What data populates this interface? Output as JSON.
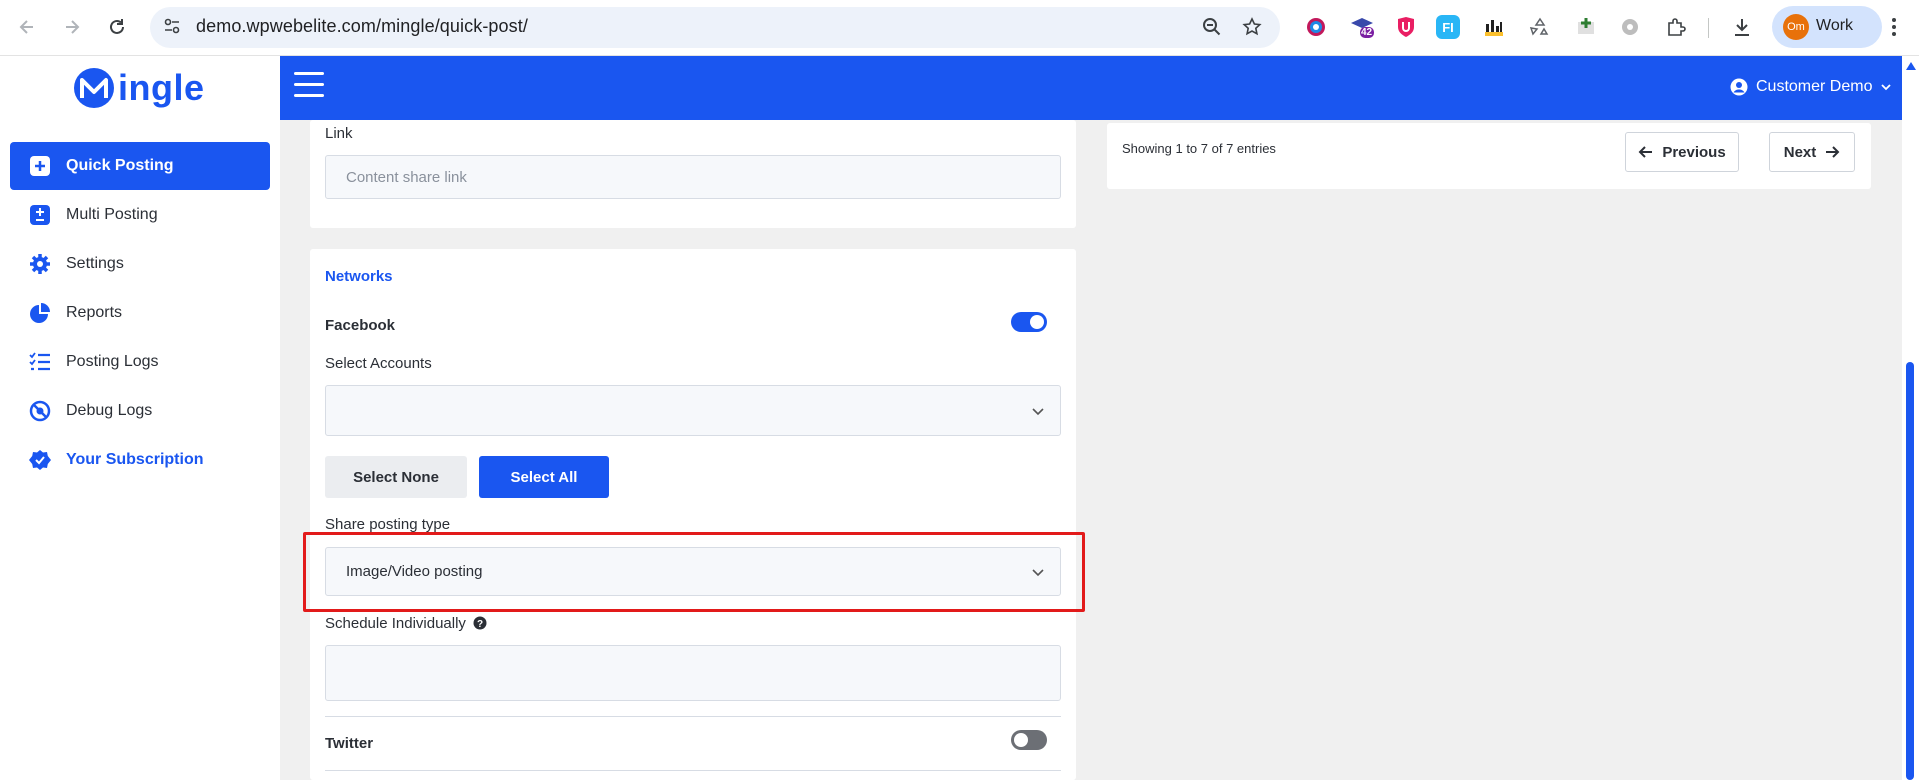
{
  "browser": {
    "url": "demo.wpwebelite.com/mingle/quick-post/",
    "profile_initials": "Om",
    "profile_label": "Work",
    "extension_badge": "42"
  },
  "brand": {
    "logo_text": "ingle",
    "accent": "#1a56f0"
  },
  "sidebar": {
    "items": [
      {
        "label": "Quick Posting",
        "icon": "plus-square-icon"
      },
      {
        "label": "Multi Posting",
        "icon": "plus-minus-icon"
      },
      {
        "label": "Settings",
        "icon": "gear-icon"
      },
      {
        "label": "Reports",
        "icon": "pie-chart-icon"
      },
      {
        "label": "Posting Logs",
        "icon": "list-check-icon"
      },
      {
        "label": "Debug Logs",
        "icon": "bug-icon"
      },
      {
        "label": "Your Subscription",
        "icon": "badge-check-icon"
      }
    ]
  },
  "header": {
    "user": "Customer Demo"
  },
  "link_section": {
    "label": "Link",
    "placeholder": "Content share link"
  },
  "networks": {
    "title": "Networks",
    "facebook": {
      "label": "Facebook",
      "enabled": true,
      "select_accounts_label": "Select Accounts",
      "select_accounts_value": "",
      "select_none": "Select None",
      "select_all": "Select All",
      "share_type_label": "Share posting type",
      "share_type_value": "Image/Video posting",
      "schedule_label": "Schedule Individually",
      "schedule_value": ""
    },
    "twitter": {
      "label": "Twitter",
      "enabled": false
    }
  },
  "pagination": {
    "info": "Showing 1 to 7 of 7 entries",
    "previous": "Previous",
    "next": "Next"
  }
}
